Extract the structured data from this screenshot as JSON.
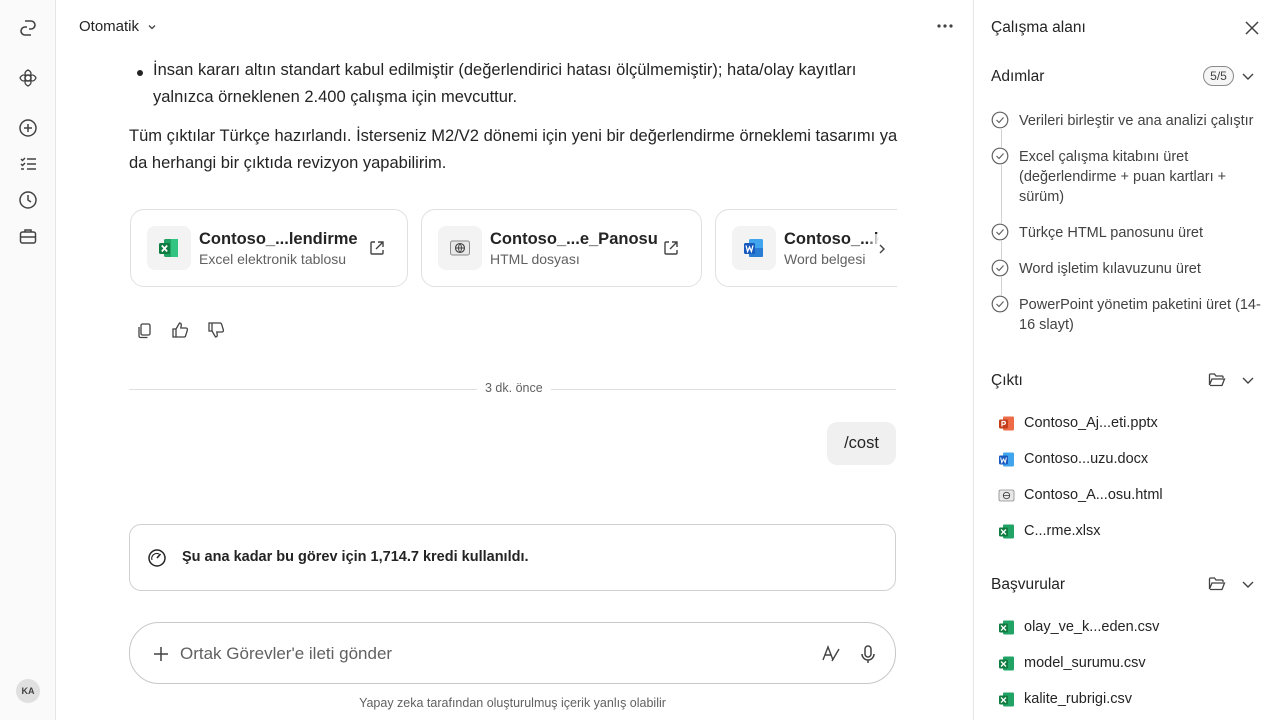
{
  "rail": {
    "avatar_initials": "KA"
  },
  "header": {
    "mode_label": "Otomatik"
  },
  "message": {
    "bullet_text": "İnsan kararı altın standart kabul edilmiştir (değerlendirici hatası ölçülmemiştir); hata/olay kayıtları yalnızca örneklenen 2.400 çalışma için mevcuttur.",
    "summary_text": "Tüm çıktılar Türkçe hazırlandı. İsterseniz M2/V2 dönemi için yeni bir değerlendirme örneklemi tasarımı ya da herhangi bir çıktıda revizyon yapabilirim."
  },
  "cards": [
    {
      "title": "Contoso_...lendirme",
      "subtitle": "Excel elektronik tablosu",
      "icon": "excel-icon"
    },
    {
      "title": "Contoso_...e_Panosu",
      "subtitle": "HTML dosyası",
      "icon": "html-globe-icon"
    },
    {
      "title": "Contoso_...k",
      "subtitle": "Word belgesi",
      "icon": "word-icon"
    }
  ],
  "divider_time": "3 dk. önce",
  "user_message": "/cost",
  "cost_text": "Şu ana kadar bu görev için 1,714.7 kredi kullanıldı.",
  "composer": {
    "placeholder": "Ortak Görevler'e ileti gönder"
  },
  "disclaimer": "Yapay zeka tarafından oluşturulmuş içerik yanlış olabilir",
  "panel": {
    "title": "Çalışma alanı",
    "steps_heading": "Adımlar",
    "steps_badge": "5/5",
    "steps": [
      "Verileri birleştir ve ana analizi çalıştır",
      "Excel çalışma kitabını üret (değerlendirme + puan kartları + sürüm)",
      "Türkçe HTML panosunu üret",
      "Word işletim kılavuzunu üret",
      "PowerPoint yönetim paketini üret (14-16 slayt)"
    ],
    "output_heading": "Çıktı",
    "outputs": [
      {
        "name": "Contoso_Aj...eti.pptx",
        "type": "pptx"
      },
      {
        "name": "Contoso...uzu.docx",
        "type": "docx"
      },
      {
        "name": "Contoso_A...osu.html",
        "type": "html"
      },
      {
        "name": "C...rme.xlsx",
        "type": "xlsx"
      }
    ],
    "refs_heading": "Başvurular",
    "references": [
      {
        "name": "olay_ve_k...eden.csv",
        "type": "csv"
      },
      {
        "name": "model_surumu.csv",
        "type": "csv"
      },
      {
        "name": "kalite_rubrigi.csv",
        "type": "csv"
      }
    ]
  },
  "colors": {
    "excel": "#107c41",
    "word": "#185abd",
    "powerpoint": "#c43e1c",
    "text": "#242424",
    "muted": "#616161"
  }
}
